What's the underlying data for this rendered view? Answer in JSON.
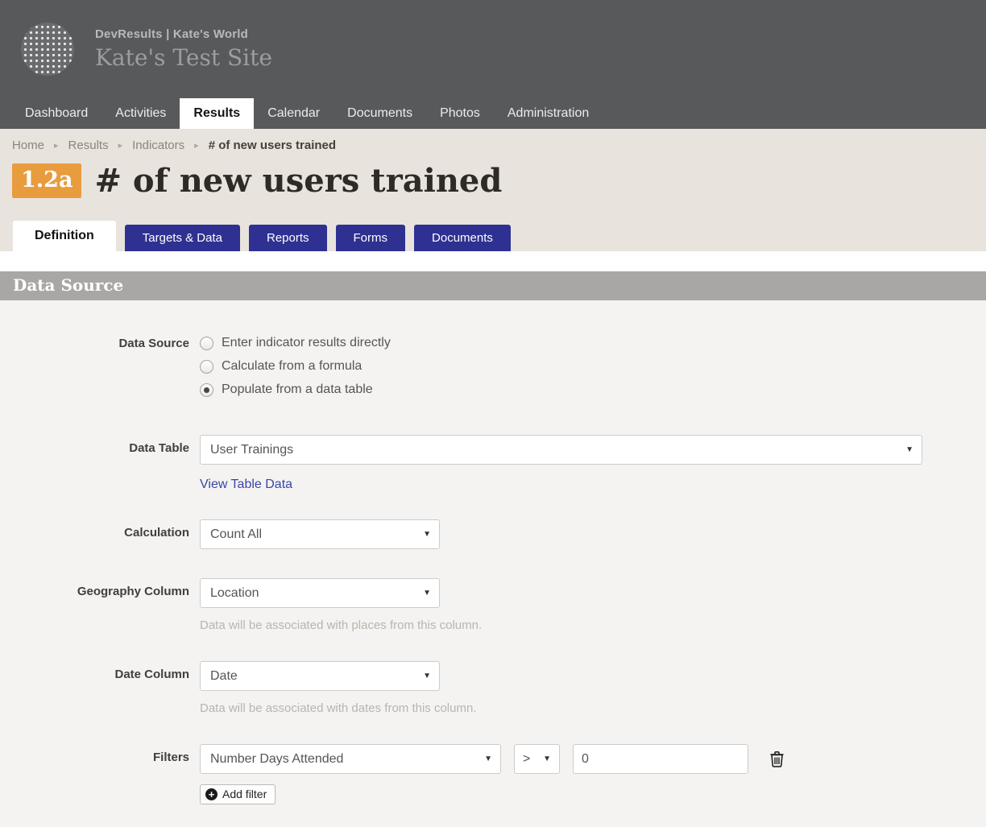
{
  "header": {
    "app_title": "DevResults | Kate's World",
    "site_title": "Kate's Test Site"
  },
  "nav": {
    "items": [
      {
        "label": "Dashboard",
        "active": false
      },
      {
        "label": "Activities",
        "active": false
      },
      {
        "label": "Results",
        "active": true
      },
      {
        "label": "Calendar",
        "active": false
      },
      {
        "label": "Documents",
        "active": false
      },
      {
        "label": "Photos",
        "active": false
      },
      {
        "label": "Administration",
        "active": false
      }
    ]
  },
  "breadcrumb": {
    "items": [
      "Home",
      "Results",
      "Indicators",
      "# of new users trained"
    ]
  },
  "page": {
    "badge": "1.2a",
    "title": "# of new users trained",
    "badge_color": "#e89c3e"
  },
  "tabs": [
    {
      "label": "Definition",
      "active": true
    },
    {
      "label": "Targets & Data",
      "active": false
    },
    {
      "label": "Reports",
      "active": false
    },
    {
      "label": "Forms",
      "active": false
    },
    {
      "label": "Documents",
      "active": false
    }
  ],
  "section": {
    "title": "Data Source"
  },
  "form": {
    "data_source": {
      "label": "Data Source",
      "options": [
        {
          "label": "Enter indicator results directly",
          "selected": false
        },
        {
          "label": "Calculate from a formula",
          "selected": false
        },
        {
          "label": "Populate from a data table",
          "selected": true
        }
      ]
    },
    "data_table": {
      "label": "Data Table",
      "value": "User Trainings",
      "link_label": "View Table Data"
    },
    "calculation": {
      "label": "Calculation",
      "value": "Count All"
    },
    "geography": {
      "label": "Geography Column",
      "value": "Location",
      "help": "Data will be associated with places from this column."
    },
    "date": {
      "label": "Date Column",
      "value": "Date",
      "help": "Data will be associated with dates from this column."
    },
    "filters": {
      "label": "Filters",
      "column_value": "Number Days Attended",
      "operator_value": ">",
      "value": "0",
      "add_label": "Add filter"
    }
  },
  "colors": {
    "masthead": "#58595b",
    "tab_blue": "#2e3191",
    "band_beige": "#e8e3dd",
    "section_gray": "#a8a7a5",
    "link_blue": "#3a45a8"
  }
}
